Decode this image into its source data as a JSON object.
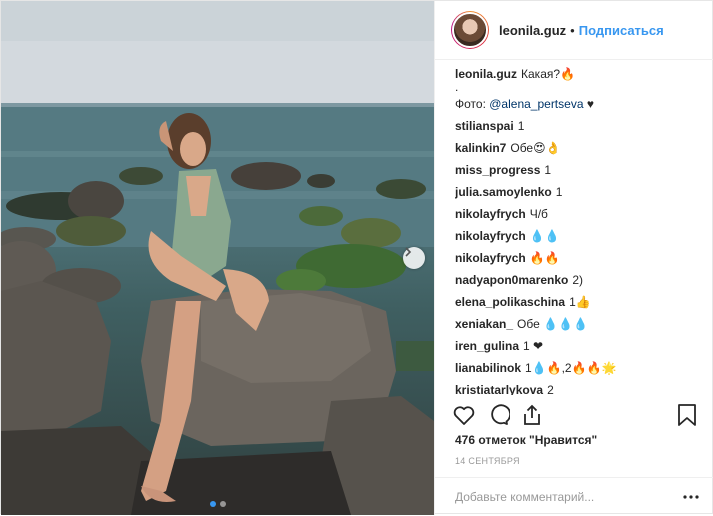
{
  "post": {
    "username": "leonila.guz",
    "separator": "•",
    "follow_label": "Подписаться",
    "caption_text": "Какая?",
    "caption_emoji": "🔥",
    "caption_dot": ".",
    "photo_credit_label": "Фото:",
    "photo_credit_mention": "@alena_pertseva",
    "photo_credit_heart": "♥"
  },
  "comments": [
    {
      "user": "stilianspai",
      "text": "1"
    },
    {
      "user": "kalinkin7",
      "text": "Обе😍👌"
    },
    {
      "user": "miss_progress",
      "text": "1"
    },
    {
      "user": "julia.samoylenko",
      "text": "1"
    },
    {
      "user": "nikolayfrych",
      "text": "Ч/б"
    },
    {
      "user": "nikolayfrych",
      "text": "💧💧"
    },
    {
      "user": "nikolayfrych",
      "text": "🔥🔥"
    },
    {
      "user": "nadyapon0marenko",
      "text": "2)"
    },
    {
      "user": "elena_polikaschina",
      "text": "1👍"
    },
    {
      "user": "xeniakan_",
      "text": "Обе 💧💧💧"
    },
    {
      "user": "iren_gulina",
      "text": "1 ❤"
    },
    {
      "user": "lianabilinok",
      "text": "1💧🔥,2🔥🔥🌟"
    },
    {
      "user": "kristiatarlykova",
      "text": "2"
    }
  ],
  "likes_text": "476 отметок \"Нравится\"",
  "date_text": "14 сентября",
  "add_comment_placeholder": "Добавьте комментарий...",
  "carousel": {
    "current": 1,
    "total": 2
  },
  "colors": {
    "accent": "#3897f0",
    "text": "#262626",
    "muted": "#999999",
    "border": "#efefef"
  },
  "icons": [
    "heart-icon",
    "comment-icon",
    "share-icon",
    "bookmark-icon",
    "chevron-right-icon",
    "more-icon"
  ]
}
